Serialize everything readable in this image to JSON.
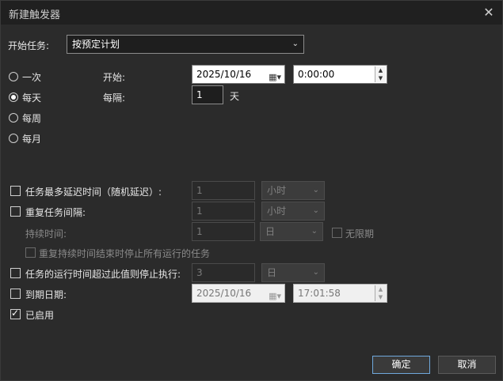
{
  "window": {
    "title": "新建触发器",
    "close_glyph": "✕"
  },
  "start_task": {
    "label": "开始任务:",
    "value": "按预定计划"
  },
  "schedule": {
    "options": [
      "一次",
      "每天",
      "每周",
      "每月"
    ],
    "selected": "每天",
    "start_label": "开始:",
    "start_date": "2025/10/16",
    "start_time": "0:00:00",
    "interval_label": "每隔:",
    "interval_value": "1",
    "interval_unit": "天"
  },
  "advanced": {
    "delay": {
      "label": "任务最多延迟时间（随机延迟）:",
      "value": "1",
      "unit": "小时",
      "checked": false
    },
    "repeat": {
      "label": "重复任务间隔:",
      "value": "1",
      "unit": "小时",
      "checked": false
    },
    "duration": {
      "label": "持续时间:",
      "value": "1",
      "unit": "日",
      "infinite_label": "无限期"
    },
    "stop_all": {
      "label": "重复持续时间结束时停止所有运行的任务"
    },
    "stop_if_longer": {
      "label": "任务的运行时间超过此值则停止执行:",
      "value": "3",
      "unit": "日",
      "checked": false
    },
    "expire": {
      "label": "到期日期:",
      "date": "2025/10/16",
      "time": "17:01:58",
      "checked": false
    },
    "enabled": {
      "label": "已启用",
      "checked": true
    }
  },
  "buttons": {
    "ok": "确定",
    "cancel": "取消"
  },
  "colors": {
    "background": "#2b2b2b",
    "titlebar": "#202020",
    "accent_border": "#6fa8dc"
  }
}
